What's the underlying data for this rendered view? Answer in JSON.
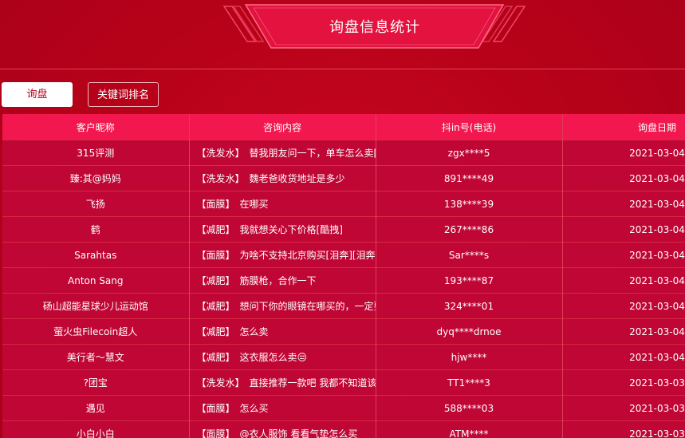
{
  "page": {
    "title": "询盘信息统计"
  },
  "tabs": [
    {
      "label": "询盘",
      "active": true
    },
    {
      "label": "关键词排名",
      "active": false
    }
  ],
  "table": {
    "headers": [
      "客户昵称",
      "咨询内容",
      "抖in号(电话)",
      "询盘日期"
    ],
    "rows": [
      {
        "nickname": "315评测",
        "tag": "【洗发水】",
        "content": "替我朋友问一下，单车怎么卖[微笑]",
        "phone": "zgx****5",
        "date": "2021-03-04"
      },
      {
        "nickname": "臻:其@妈妈",
        "tag": "【洗发水】",
        "content": "魏老爸收货地址是多少",
        "phone": "891****49",
        "date": "2021-03-04"
      },
      {
        "nickname": "飞扬",
        "tag": "【面膜】",
        "content": "在哪买",
        "phone": "138****39",
        "date": "2021-03-04"
      },
      {
        "nickname": "鹤",
        "tag": "【减肥】",
        "content": "我就想关心下价格[酷拽]",
        "phone": "267****86",
        "date": "2021-03-04"
      },
      {
        "nickname": "Sarahtas",
        "tag": "【面膜】",
        "content": "为啥不支持北京购买[泪奔][泪奔][泪奔]",
        "phone": "Sar****s",
        "date": "2021-03-04"
      },
      {
        "nickname": "Anton Sang",
        "tag": "【减肥】",
        "content": "筋膜枪，合作一下",
        "phone": "193****87",
        "date": "2021-03-04"
      },
      {
        "nickname": "砀山超能星球少儿运动馆",
        "tag": "【减肥】",
        "content": "想问下你的眼镜在哪买的，一定要告诉我",
        "phone": "324****01",
        "date": "2021-03-04"
      },
      {
        "nickname": "萤火虫Filecoin超人",
        "tag": "【减肥】",
        "content": "怎么卖",
        "phone": "dyq****drnoe",
        "date": "2021-03-04"
      },
      {
        "nickname": "美行者～慧文",
        "tag": "【减肥】",
        "content": "这衣服怎么卖😒",
        "phone": "hjw****",
        "date": "2021-03-04"
      },
      {
        "nickname": "?团宝",
        "tag": "【洗发水】",
        "content": "直接推荐一款吧 我都不知道该怎么选",
        "phone": "TT1****3",
        "date": "2021-03-03"
      },
      {
        "nickname": "遇见",
        "tag": "【面膜】",
        "content": "怎么买",
        "phone": "588****03",
        "date": "2021-03-03"
      },
      {
        "nickname": "小白小白",
        "tag": "【面膜】",
        "content": "@衣人服饰 看看气垫怎么买",
        "phone": "ATM****",
        "date": "2021-03-03"
      }
    ]
  },
  "colors": {
    "background": "#b80219",
    "header_row": "#f2184f",
    "body_row": "#bf0634",
    "banner": "#e3123f"
  }
}
